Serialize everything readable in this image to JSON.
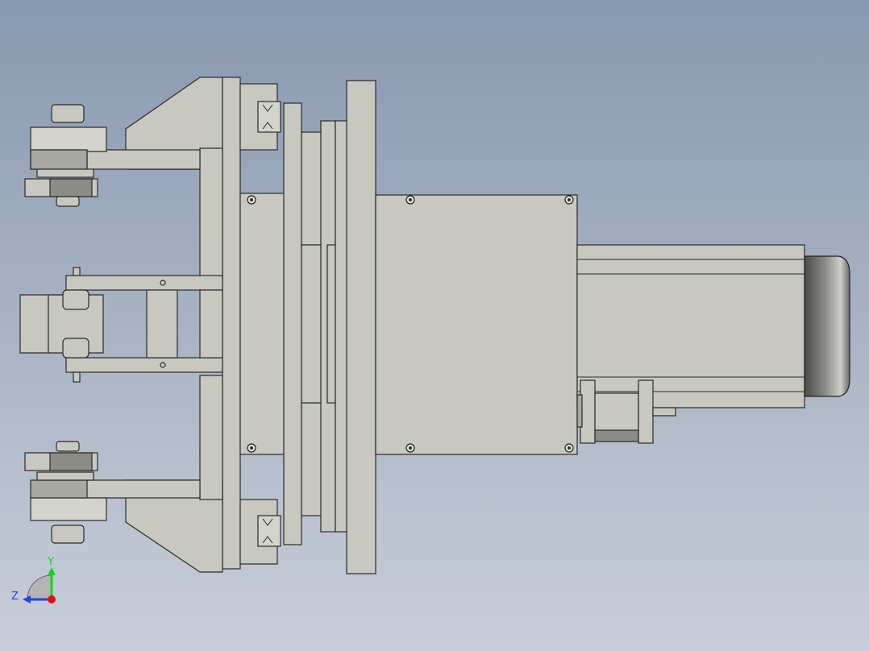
{
  "view": {
    "background_top": "#8799b0",
    "background_bottom": "#c6ccd8",
    "part_color": "#c8c8c0",
    "edge_color": "#2a2a2a"
  },
  "model": {
    "assembly": "gripper-with-motor",
    "components": [
      "upper-finger-arm",
      "middle-clamp-fingers",
      "lower-finger-arm",
      "slide-plates",
      "flange-plate",
      "gearbox-housing",
      "servo-motor",
      "motor-encoder-end",
      "bracket-connector"
    ]
  },
  "triad": {
    "y_label": "Y",
    "z_label": "Z",
    "y_color": "#22cc22",
    "z_color": "#2244dd",
    "origin_color": "#e01010"
  }
}
